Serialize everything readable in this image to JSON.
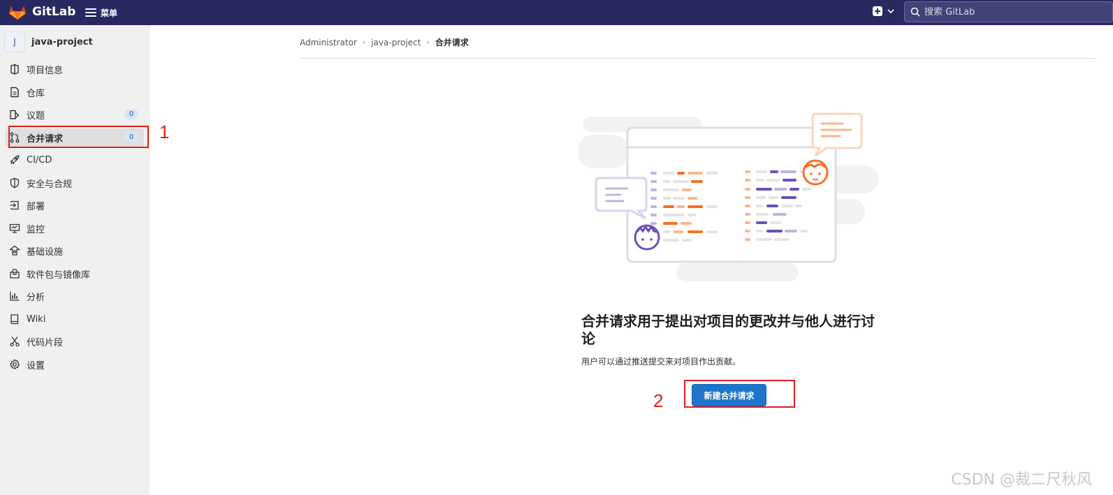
{
  "header": {
    "brand": "GitLab",
    "menu_label": "菜单",
    "search_placeholder": "搜索 GitLab"
  },
  "sidebar": {
    "project_avatar": "J",
    "project_name": "java-project",
    "items": [
      {
        "label": "项目信息",
        "icon": "project-info-icon"
      },
      {
        "label": "仓库",
        "icon": "repository-icon"
      },
      {
        "label": "议题",
        "icon": "issues-icon",
        "badge": "0"
      },
      {
        "label": "合并请求",
        "icon": "merge-request-icon",
        "badge": "0",
        "active": true
      },
      {
        "label": "CI/CD",
        "icon": "rocket-icon"
      },
      {
        "label": "安全与合规",
        "icon": "shield-icon"
      },
      {
        "label": "部署",
        "icon": "deploy-icon"
      },
      {
        "label": "监控",
        "icon": "monitor-icon"
      },
      {
        "label": "基础设施",
        "icon": "infrastructure-icon"
      },
      {
        "label": "软件包与镜像库",
        "icon": "package-icon"
      },
      {
        "label": "分析",
        "icon": "analytics-icon"
      },
      {
        "label": "Wiki",
        "icon": "book-icon"
      },
      {
        "label": "代码片段",
        "icon": "snippet-icon"
      },
      {
        "label": "设置",
        "icon": "settings-icon"
      }
    ]
  },
  "breadcrumb": [
    "Administrator",
    "java-project",
    "合并请求"
  ],
  "empty_state": {
    "title": "合并请求用于提出对项目的更改并与他人进行讨论",
    "description": "用户可以通过推送提交来对项目作出贡献。",
    "button_label": "新建合并请求"
  },
  "annotations": [
    "1",
    "2"
  ],
  "watermark": "CSDN @裁二尺秋风",
  "colors": {
    "topbar": "#292961",
    "primary": "#1f75cb",
    "annotation": "#e11d1d",
    "illustration_orange": "#fc6d26",
    "illustration_purple": "#6b4fbb"
  }
}
